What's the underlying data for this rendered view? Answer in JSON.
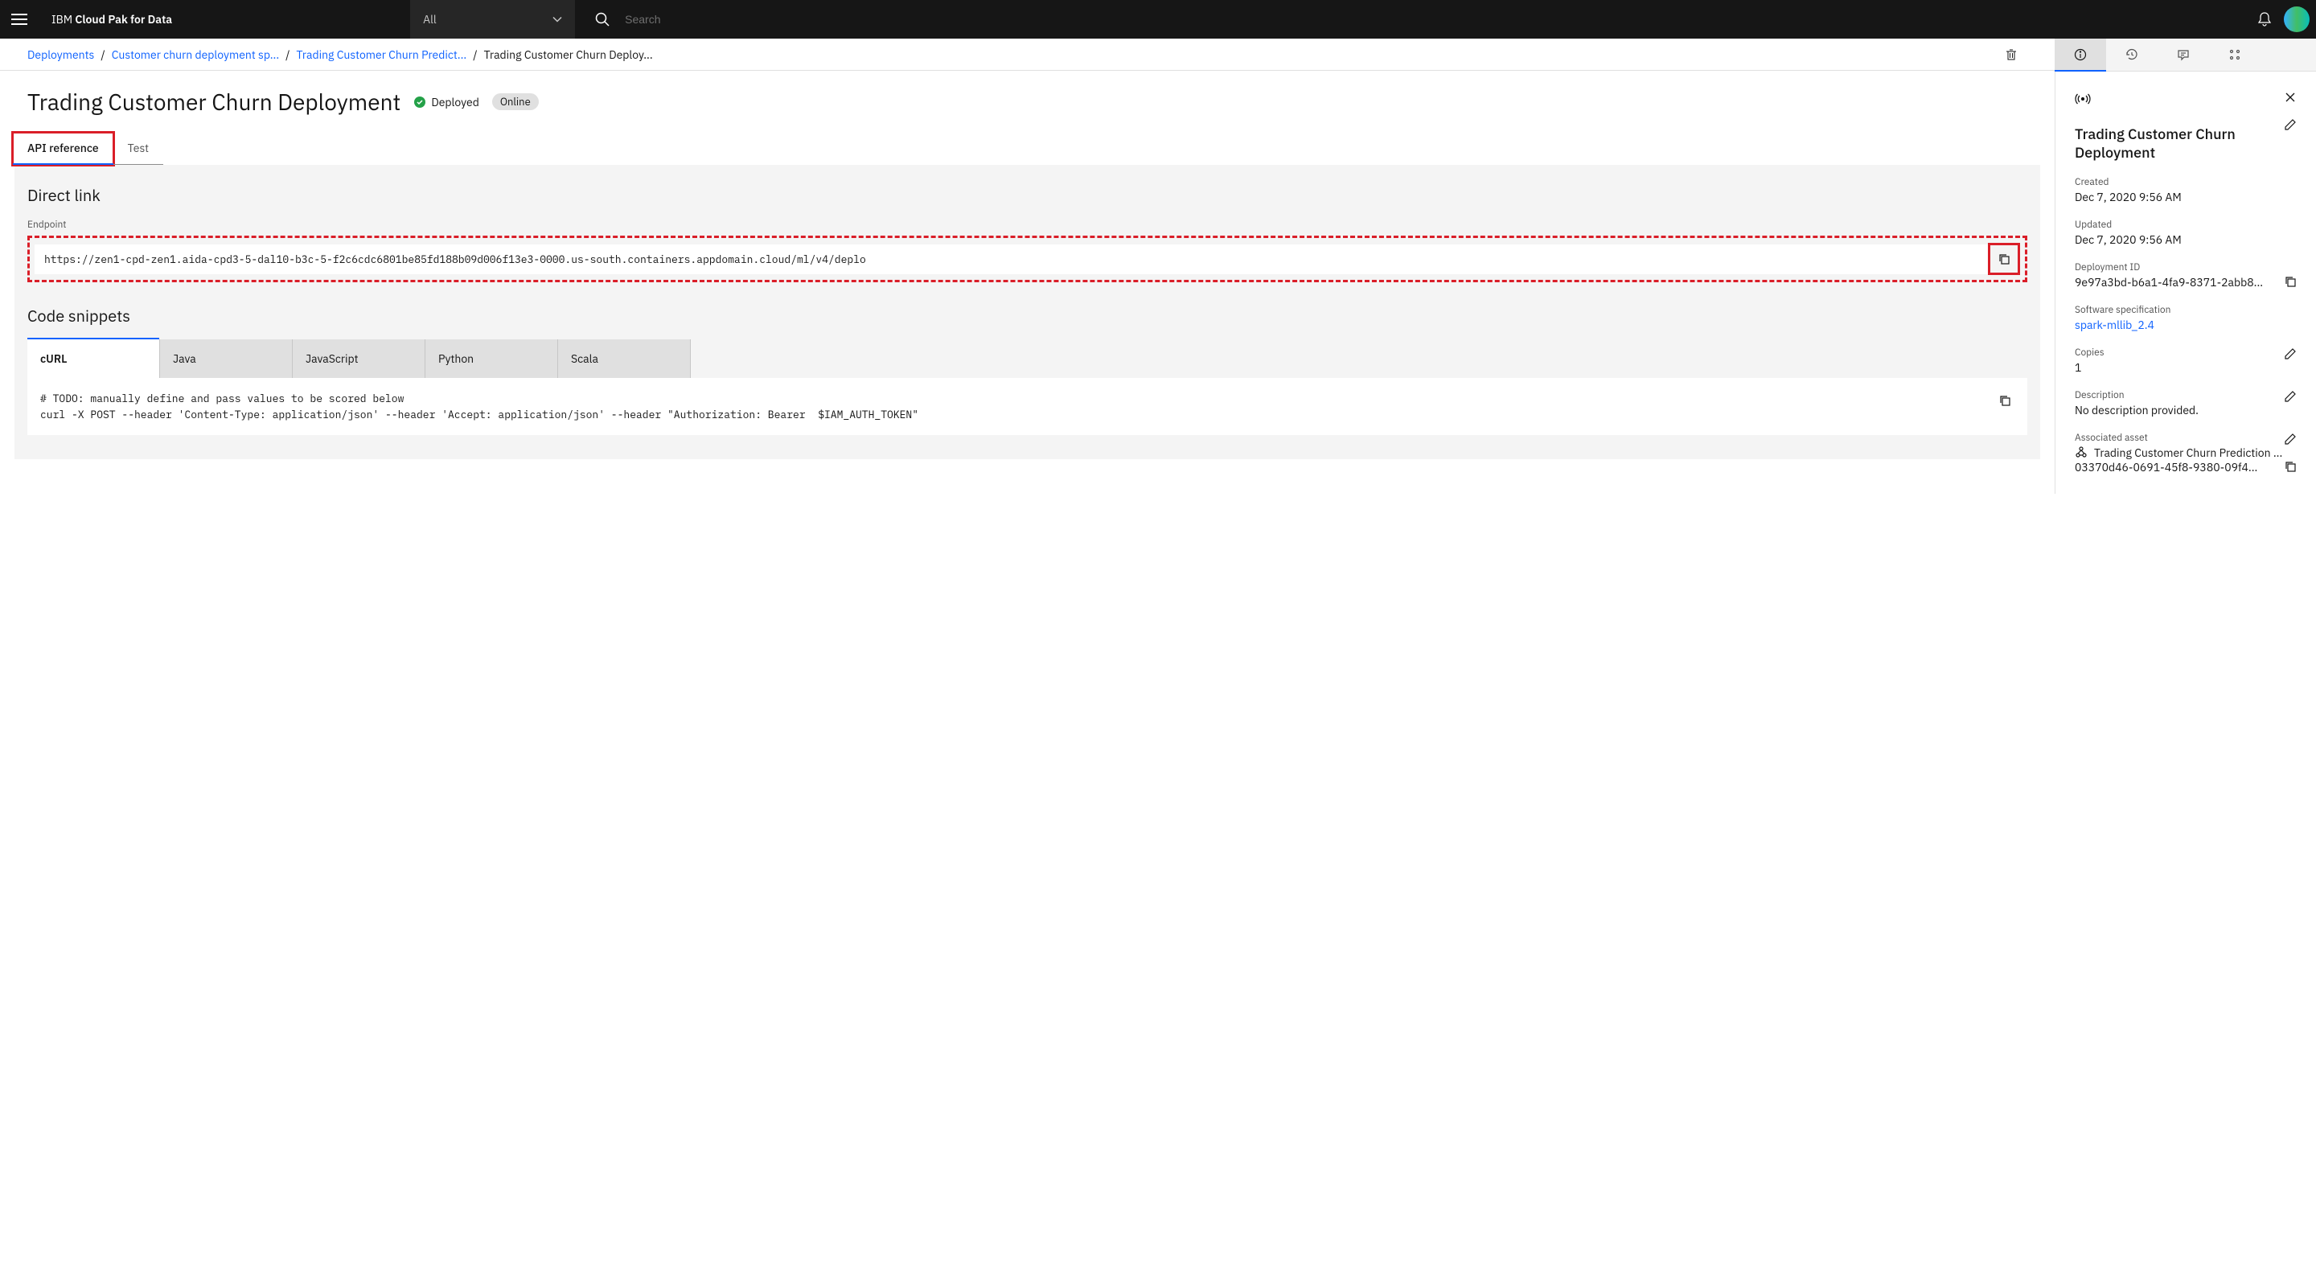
{
  "topbar": {
    "brand_prefix": "IBM ",
    "brand_bold": "Cloud Pak for Data",
    "dropdown_label": "All",
    "search_placeholder": "Search"
  },
  "breadcrumb": {
    "items": [
      {
        "label": "Deployments",
        "link": true
      },
      {
        "label": "Customer churn deployment sp...",
        "link": true
      },
      {
        "label": "Trading Customer Churn Predict...",
        "link": true
      },
      {
        "label": "Trading Customer Churn Deploy...",
        "link": false
      }
    ]
  },
  "page_title": "Trading Customer Churn Deployment",
  "status": {
    "label": "Deployed",
    "badge": "Online"
  },
  "tabs": {
    "api_ref": "API reference",
    "test": "Test"
  },
  "direct_link": {
    "heading": "Direct link",
    "label": "Endpoint",
    "value": "https://zen1-cpd-zen1.aida-cpd3-5-dal10-b3c-5-f2c6cdc6801be85fd188b09d006f13e3-0000.us-south.containers.appdomain.cloud/ml/v4/deplo"
  },
  "code_snippets": {
    "heading": "Code snippets",
    "tabs": [
      "cURL",
      "Java",
      "JavaScript",
      "Python",
      "Scala"
    ],
    "body": "# TODO: manually define and pass values to be scored below\ncurl -X POST --header 'Content-Type: application/json' --header 'Accept: application/json' --header \"Authorization: Bearer  $IAM_AUTH_TOKEN\""
  },
  "sidepanel": {
    "title": "Trading Customer Churn Deployment",
    "created_label": "Created",
    "created_value": "Dec 7, 2020 9:56 AM",
    "updated_label": "Updated",
    "updated_value": "Dec 7, 2020 9:56 AM",
    "deploy_id_label": "Deployment ID",
    "deploy_id_value": "9e97a3bd-b6a1-4fa9-8371-2abb8...",
    "softspec_label": "Software specification",
    "softspec_value": "spark-mllib_2.4",
    "copies_label": "Copies",
    "copies_value": "1",
    "desc_label": "Description",
    "desc_value": "No description provided.",
    "asset_label": "Associated asset",
    "asset_name": "Trading Customer Churn Prediction ...",
    "asset_id": "03370d46-0691-45f8-9380-09f4..."
  }
}
